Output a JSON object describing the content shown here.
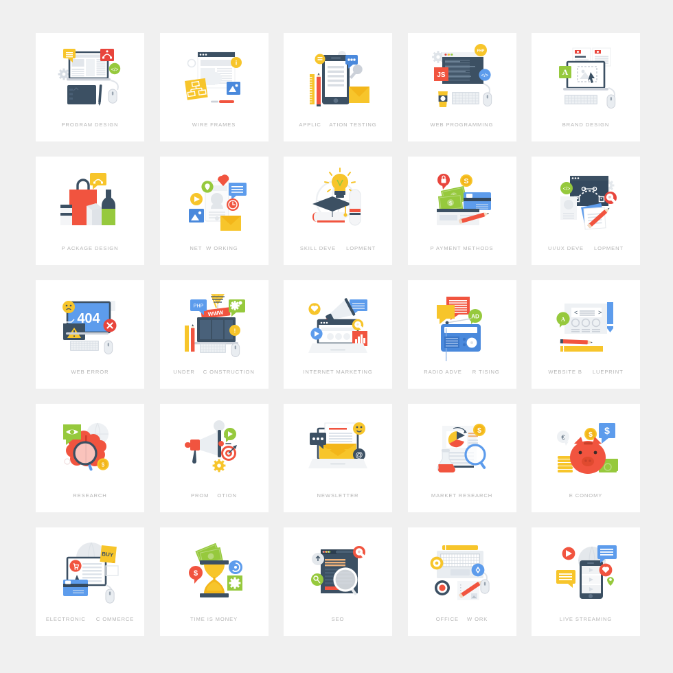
{
  "page": {
    "background_color": "#f0f0f0",
    "card_background_color": "#ffffff",
    "label_color": "#b5b5b5",
    "columns": 5,
    "rows": 5,
    "total_cards": 25
  },
  "palette": {
    "dark_navy": "#3c5063",
    "navy": "#34495e",
    "red": "#e8453c",
    "orange_red": "#f1543f",
    "yellow": "#f7c52b",
    "gold": "#f3b61a",
    "green": "#8cc152",
    "leaf_green": "#96c93d",
    "blue": "#4a89dc",
    "steel_blue": "#5d9cec",
    "light_gray": "#e6e9ee",
    "mid_gray": "#ccd1d9",
    "pale_gray": "#f0f1f3"
  },
  "cards": [
    {
      "id": "program-design",
      "label": "PROGRAM DESIGN",
      "icon": "desktop-tablet-pen-mouse"
    },
    {
      "id": "wire-frames",
      "label": "WIRE FRAMES",
      "icon": "browser-sticky-note-image"
    },
    {
      "id": "application-testing",
      "label": "APPLIC    ATION TESTING",
      "icon": "smartphone-ruler-pencil-envelope"
    },
    {
      "id": "web-programming",
      "label": "WEB PROGRAMMING",
      "icon": "code-window-coffee-keyboard"
    },
    {
      "id": "brand-design",
      "label": "BRAND DESIGN",
      "icon": "laptop-documents-cursor"
    },
    {
      "id": "package-design",
      "label": "P ACKAGE DESIGN",
      "icon": "shopping-bag-bottle-boxes"
    },
    {
      "id": "networking",
      "label": "NET  W ORKING",
      "icon": "phone-social-bubbles"
    },
    {
      "id": "skill-development",
      "label": "SKILL DEVE     LOPMENT",
      "icon": "graduation-cap-bulb-diploma"
    },
    {
      "id": "payment-methods",
      "label": "P AYMENT METHODS",
      "icon": "cash-credit-card-lock"
    },
    {
      "id": "ui-ux-development",
      "label": "UI/UX DEVE     LOPMENT",
      "icon": "bezier-window-pencil-papers"
    },
    {
      "id": "web-error",
      "label": "WEB ERROR",
      "icon": "monitor-404-warning"
    },
    {
      "id": "under-construction",
      "label": "UNDER    C ONSTRUCTION",
      "icon": "www-banner-crane-monitor"
    },
    {
      "id": "internet-marketing",
      "label": "INTERNET MARKETING",
      "icon": "laptop-megaphone-chart"
    },
    {
      "id": "radio-advertising",
      "label": "RADIO ADVE     R TISING",
      "icon": "radio-speech-bubbles-ad"
    },
    {
      "id": "website-blueprint",
      "label": "WEBSITE B     LUEPRINT",
      "icon": "wireframe-sheet-pencil-ruler"
    },
    {
      "id": "research",
      "label": "RESEARCH",
      "icon": "brain-magnifier-eye"
    },
    {
      "id": "promotion",
      "label": "PROM    OTION",
      "icon": "megaphone-target-gear"
    },
    {
      "id": "newsletter",
      "label": "NEWSLETTER",
      "icon": "laptop-envelope-letter"
    },
    {
      "id": "market-research",
      "label": "MARKET RESEARCH",
      "icon": "document-chart-flask-magnifier"
    },
    {
      "id": "economy",
      "label": "E CONOMY",
      "icon": "piggy-bank-coins-money"
    },
    {
      "id": "electronic-commerce",
      "label": "ELECTRONIC     C OMMERCE",
      "icon": "monitor-cart-credit-card-buy"
    },
    {
      "id": "time-is-money",
      "label": "TIME IS MONEY",
      "icon": "hourglass-money-gear"
    },
    {
      "id": "seo",
      "label": "SEO",
      "icon": "document-magnifier-search"
    },
    {
      "id": "office-work",
      "label": "OFFICE    W ORK",
      "icon": "keyboard-mouse-pencil-notes"
    },
    {
      "id": "live-streaming",
      "label": "LIVE STREAMING",
      "icon": "smartphone-play-chat-globe"
    }
  ]
}
